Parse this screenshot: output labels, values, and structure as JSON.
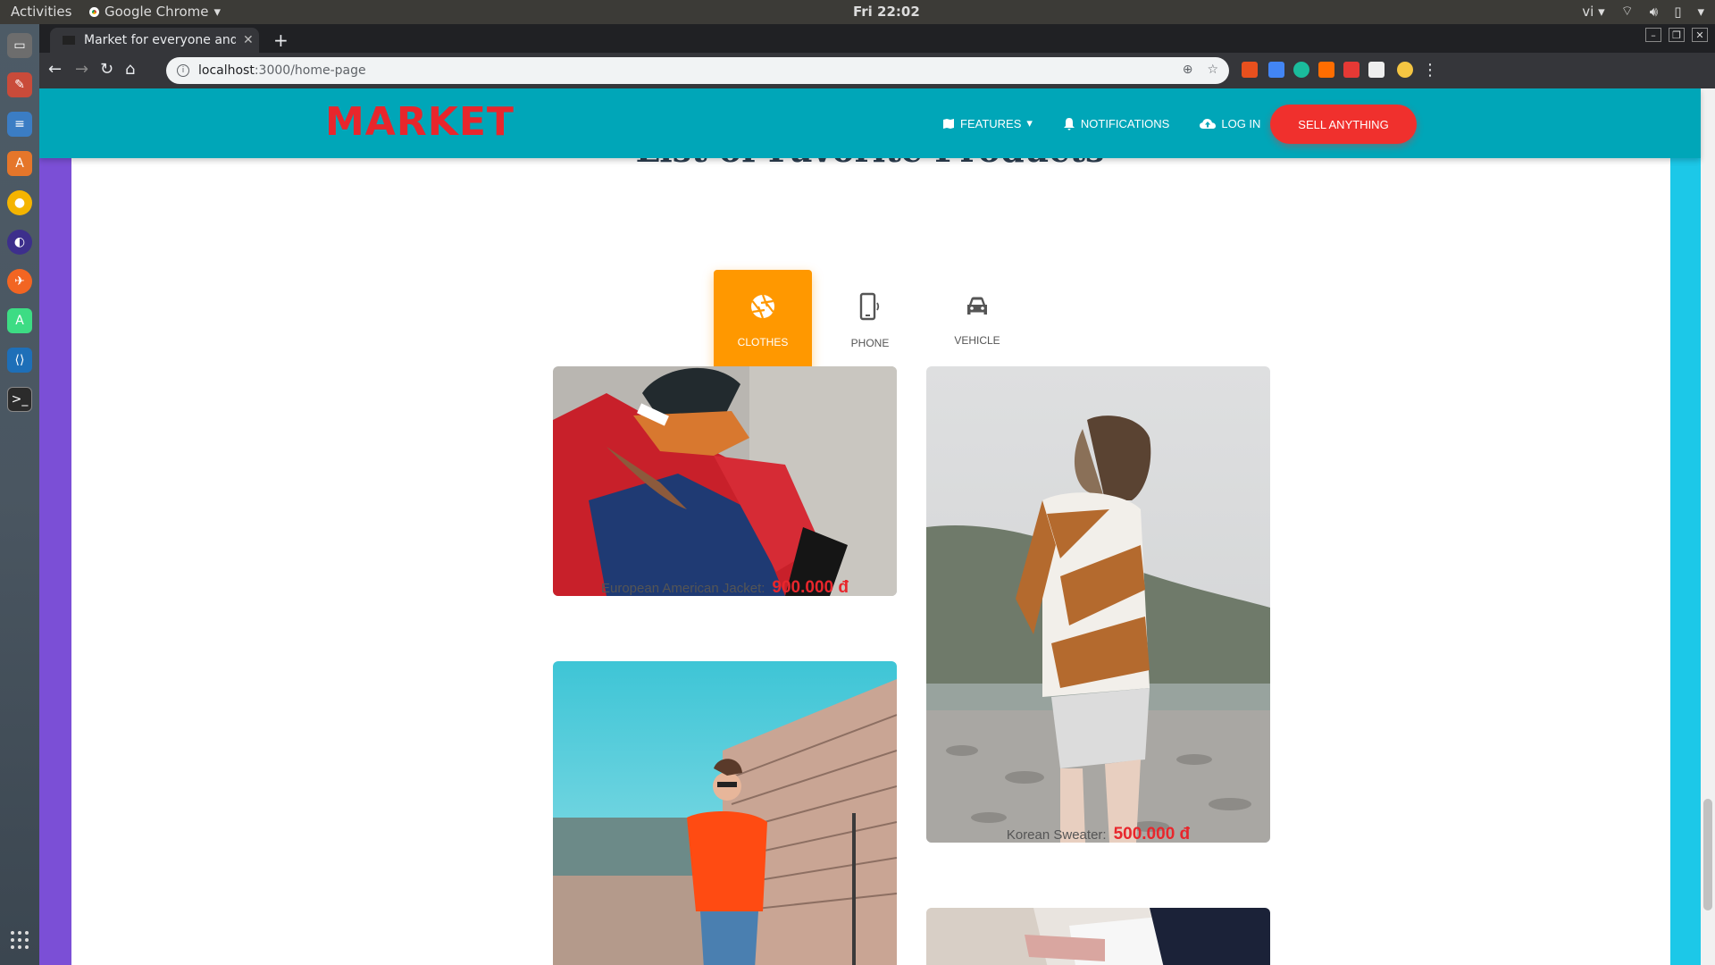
{
  "os_bar": {
    "activities": "Activities",
    "app_name": "Google Chrome",
    "clock": "Fri 22:02",
    "lang": "vi"
  },
  "browser": {
    "tab_title": "Market for everyone and everything",
    "url_host": "localhost",
    "url_path": ":3000/home-page"
  },
  "site": {
    "logo": "MARKET",
    "nav": {
      "features": "FEATURES",
      "notifications": "NOTIFICATIONS",
      "login": "LOG IN",
      "sell": "SELL ANYTHING"
    },
    "heading": "List of Favorite Products",
    "categories": [
      {
        "label": "CLOTHES",
        "icon": "aperture-icon",
        "active": true
      },
      {
        "label": "PHONE",
        "icon": "phone-icon",
        "active": false
      },
      {
        "label": "VEHICLE",
        "icon": "car-icon",
        "active": false
      }
    ],
    "products": [
      {
        "name": "European American Jacket:",
        "price": "900.000 đ"
      },
      {
        "name": "Korean Sweater:",
        "price": "500.000 đ"
      }
    ]
  },
  "colors": {
    "navbar": "#00a6b8",
    "logo": "#e8262c",
    "sell_button": "#f0302d",
    "active_category": "#ff9800",
    "price": "#e8262c"
  }
}
